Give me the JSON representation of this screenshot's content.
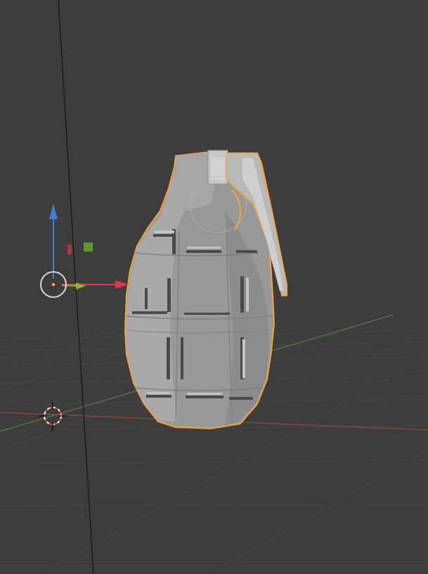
{
  "viewport": {
    "background": "#3d3d3d",
    "grid_color": "#484848",
    "x_axis_color": "#a34848",
    "y_axis_color": "#6a8a3a"
  },
  "object": {
    "icon": "hand-grenade",
    "selected": true,
    "selection_outline_color": "#f5a33a",
    "body_color": "#9e9e9e"
  },
  "gizmo": {
    "z_axis_color": "#3d7fdc",
    "x_axis_color": "#e0384b",
    "y_axis_color": "#7fbf2e",
    "origin_color": "#f5a33a",
    "pivot_ring_color": "#d8d8d8"
  },
  "cursor_3d": {
    "icon": "3d-cursor-icon",
    "ring_colors": [
      "#e23a3a",
      "#ffffff"
    ]
  }
}
